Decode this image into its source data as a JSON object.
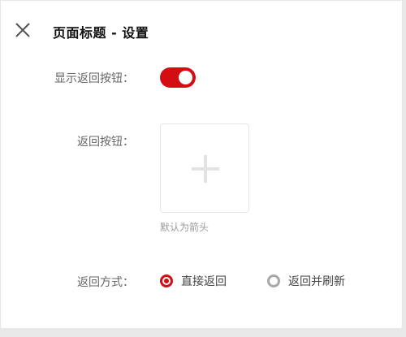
{
  "header": {
    "title": "页面标题 - 设置",
    "close_icon": "close-icon"
  },
  "form": {
    "show_back_button": {
      "label": "显示返回按钮：",
      "enabled": true,
      "accent": "#d40d12"
    },
    "back_button": {
      "label": "返回按钮：",
      "upload_icon": "plus-icon",
      "hint": "默认为箭头"
    },
    "back_mode": {
      "label": "返回方式：",
      "options": [
        {
          "label": "直接返回",
          "checked": true
        },
        {
          "label": "返回并刷新",
          "checked": false
        }
      ]
    }
  }
}
